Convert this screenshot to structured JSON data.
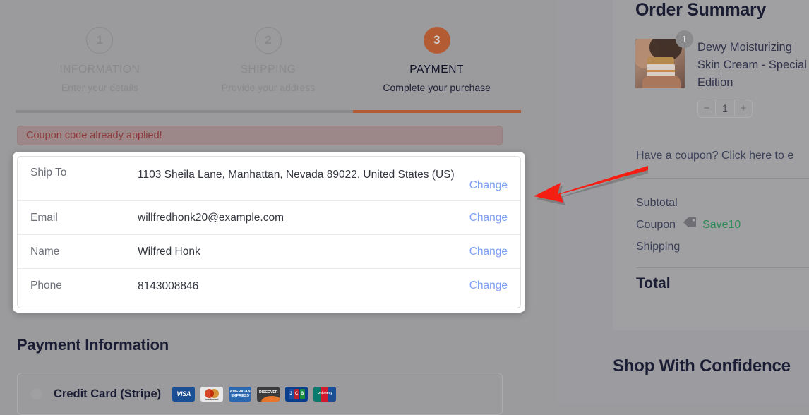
{
  "stepper": {
    "steps": [
      {
        "num": "1",
        "title": "INFORMATION",
        "sub": "Enter your details",
        "state": "done"
      },
      {
        "num": "2",
        "title": "SHIPPING",
        "sub": "Provide your address",
        "state": "done"
      },
      {
        "num": "3",
        "title": "PAYMENT",
        "sub": "Complete your purchase",
        "state": "active"
      }
    ]
  },
  "alert": {
    "message": "Coupon code already applied!",
    "bg_color": "#9d8889",
    "text_color": "#8d3b3d"
  },
  "details": {
    "change_label": "Change",
    "rows": [
      {
        "label": "Ship To",
        "value": "1103 Sheila Lane, Manhattan, Nevada 89022, United States (US)"
      },
      {
        "label": "Email",
        "value": "willfredhonk20@example.com"
      },
      {
        "label": "Name",
        "value": "Wilfred Honk"
      },
      {
        "label": "Phone",
        "value": "8143008846"
      }
    ]
  },
  "payment": {
    "heading": "Payment Information",
    "method_label": "Credit Card (Stripe)",
    "cards": [
      "VISA",
      "mastercard",
      "AMERICAN EXPRESS",
      "DISCOVER",
      "JCB",
      "UnionPay"
    ]
  },
  "sidebar": {
    "title": "Order Summary",
    "product": {
      "name": "Dewy Moisturizing Skin Cream - Special Edition",
      "badge_qty": "1",
      "qty_value": "1",
      "qty_minus": "−",
      "qty_plus": "+"
    },
    "coupon_link": "Have a coupon? Click here to e",
    "totals": [
      {
        "label": "Subtotal"
      },
      {
        "label": "Coupon",
        "code": "Save10",
        "code_color": "#2e8b57"
      },
      {
        "label": "Shipping"
      }
    ],
    "total_label": "Total",
    "confidence_heading": "Shop With Confidence"
  },
  "annotation": {
    "arrow_color": "#f41f12"
  }
}
